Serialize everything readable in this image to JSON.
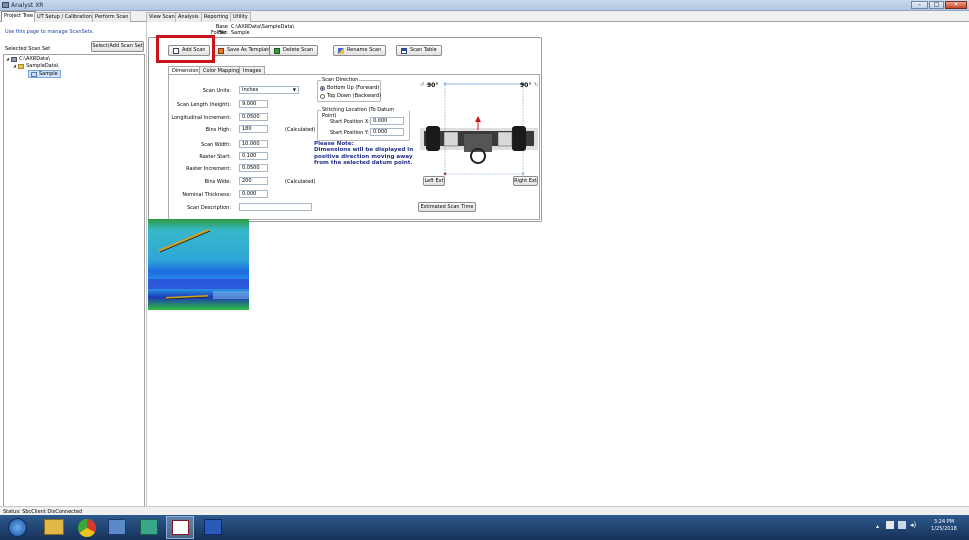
{
  "window": {
    "title": "Analyst XR",
    "controls": [
      "–",
      "□",
      "✕"
    ]
  },
  "tabs": [
    {
      "label": "Project Tree",
      "active": true
    },
    {
      "label": "UT Setup / Calibration"
    },
    {
      "label": "Perform Scan"
    },
    {
      "label": "View Scan"
    },
    {
      "label": "Analysis"
    },
    {
      "label": "Reporting"
    },
    {
      "label": "Utility"
    }
  ],
  "left_panel": {
    "manage_link": "Use this page to manage ScanSets.",
    "selected_label": "Selected Scan Set",
    "select_add_button": "Select/Add Scan Set",
    "tree": {
      "root": "C:\\AXRData\\",
      "folder": "SampleData\\",
      "scan": "Sample"
    }
  },
  "header": {
    "base_folder_label": "Base Folder:",
    "base_folder_value": "C:\\AXRData\\SampleData\\",
    "file_label": "File:",
    "file_value": "Sample"
  },
  "toolbar": {
    "add_scan": "Add Scan",
    "save_as_template": "Save As Template",
    "delete_scan": "Delete Scan",
    "rename_scan": "Rename Scan",
    "scan_table": "Scan Table"
  },
  "inner_tabs": [
    "Dimensions",
    "Color Mapping",
    "Images"
  ],
  "dimensions": {
    "scan_units_label": "Scan Units:",
    "scan_units_value": "Inches",
    "scan_length_label": "Scan Length (height):",
    "scan_length_value": "9.000",
    "long_inc_label": "Longitudinal Increment:",
    "long_inc_value": "0.0500",
    "bins_high_label": "Bins High:",
    "bins_high_value": "180",
    "calculated": "(Calculated)",
    "scan_width_label": "Scan Width:",
    "scan_width_value": "10.000",
    "raster_start_label": "Raster Start:",
    "raster_start_value": "0.100",
    "raster_inc_label": "Raster Increment:",
    "raster_inc_value": "0.0500",
    "bins_wide_label": "Bins Wide:",
    "bins_wide_value": "200",
    "nominal_label": "Nominal Thickness:",
    "nominal_value": "0.000",
    "desc_label": "Scan Description:",
    "desc_value": ""
  },
  "scan_direction": {
    "title": "Scan Direction",
    "option1": "Bottom Up (Forward)",
    "option2": "Top Down (Backward)",
    "selected": 1
  },
  "stitching": {
    "title": "Stitching Location  (To Datum Point)",
    "x_label": "Start Position X:",
    "x_value": "0.000",
    "y_label": "Start Position Y:",
    "y_value": "0.000"
  },
  "note": "Please Note:\nDimensions will be displayed in positive direction moving away from the selected datum point.",
  "diagram": {
    "angle_left": "90°",
    "angle_right": "90°",
    "left_ext": "Left Ext",
    "right_ext": "Right Ext",
    "estimated_button": "Estimated Scan Time"
  },
  "status": {
    "text": "Status: SbcClient DisConnected"
  },
  "taskbar": {
    "time": "3:24 PM",
    "date": "1/25/2018"
  },
  "colors": {
    "highlight": "#c8141a",
    "note": "#1f2f8a",
    "taskbar": "#1b3f6e"
  }
}
